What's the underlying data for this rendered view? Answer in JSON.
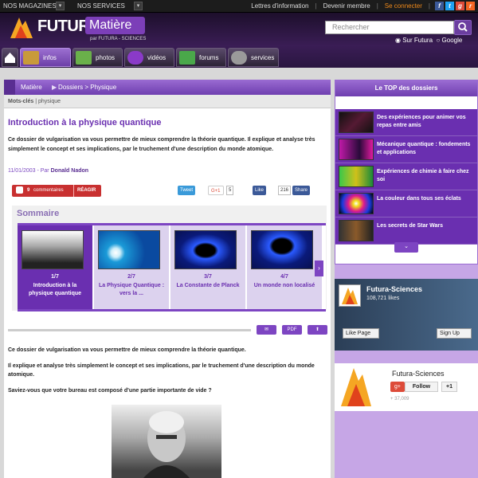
{
  "topbar": {
    "magazines": "NOS MAGAZINES",
    "services": "NOS SERVICES",
    "newsletter": "Lettres d'information",
    "join": "Devenir membre",
    "login": "Se connecter",
    "social": [
      "facebook-icon",
      "twitter-icon",
      "google-plus-icon",
      "rss-icon"
    ]
  },
  "header": {
    "brand": "FUTURA",
    "section": "Matière",
    "sub": "par FUTURA - SCIENCES",
    "search_placeholder": "Rechercher",
    "search_opt_1": "Sur Futura",
    "search_opt_2": "Google"
  },
  "nav": {
    "items": [
      {
        "label": "",
        "icon": "home-icon"
      },
      {
        "label": "infos",
        "icon": "books-icon"
      },
      {
        "label": "photos",
        "icon": "photo-icon"
      },
      {
        "label": "vidéos",
        "icon": "video-icon"
      },
      {
        "label": "forums",
        "icon": "chat-icon"
      },
      {
        "label": "services",
        "icon": "gears-icon"
      }
    ]
  },
  "breadcrumb": {
    "section": "Matière",
    "path": "Dossiers > Physique"
  },
  "tags": {
    "label": "Mots-clés",
    "value": "physique"
  },
  "article": {
    "title": "Introduction à la physique quantique",
    "intro": "Ce dossier de vulgarisation va vous permettre de mieux comprendre la théorie quantique. Il explique et analyse très simplement le concept et ses implications, par le truchement d'une description du monde atomique.",
    "date": "11/01/2003",
    "by": "Par",
    "author": "Donald Nadon",
    "comments_count": "9",
    "comments_label": "commentaires",
    "react_label": "RÉAGIR",
    "tweet": "Tweet",
    "gplus": "G+1",
    "gplus_count": "5",
    "like": "Like",
    "like_count": "216",
    "share": "Share",
    "p1": "Ce dossier de vulgarisation va vous permettre de mieux comprendre la théorie quantique.",
    "p2": "Il explique et analyse très simplement le concept et ses implications, par le truchement d'une description du monde atomique.",
    "p3": "Saviez-vous que votre bureau est composé d'une partie importante de vide ?"
  },
  "sommaire": {
    "title": "Sommaire",
    "slides": [
      {
        "num": "1/7",
        "title": "Introduction à la physique quantique"
      },
      {
        "num": "2/7",
        "title": "La Physique Quantique : vers la ..."
      },
      {
        "num": "3/7",
        "title": "La Constante de Planck"
      },
      {
        "num": "4/7",
        "title": "Un monde non localisé"
      }
    ],
    "next": "›"
  },
  "tools": {
    "print": "PDF",
    "mail": "✉",
    "share": "⬆"
  },
  "sidebar": {
    "top_title": "Le TOP des dossiers",
    "top_items": [
      "Des expériences pour animer vos repas entre amis",
      "Mécanique quantique : fondements et applications",
      "Expériences de chimie à faire chez soi",
      "La couleur dans tous ses éclats",
      "Les secrets de Star Wars"
    ],
    "top_more": "⌄",
    "fb_name": "Futura-Sciences",
    "fb_likes": "108,721 likes",
    "fb_like": "Like Page",
    "fb_signup": "Sign Up",
    "gp_name": "Futura-Sciences",
    "gp_follow": "Follow",
    "gp_plus1": "+1",
    "gp_count": "+ 37,009"
  },
  "colors": {
    "accent": "#6a2fb0",
    "header": "#3a1d55",
    "react": "#c83030"
  }
}
